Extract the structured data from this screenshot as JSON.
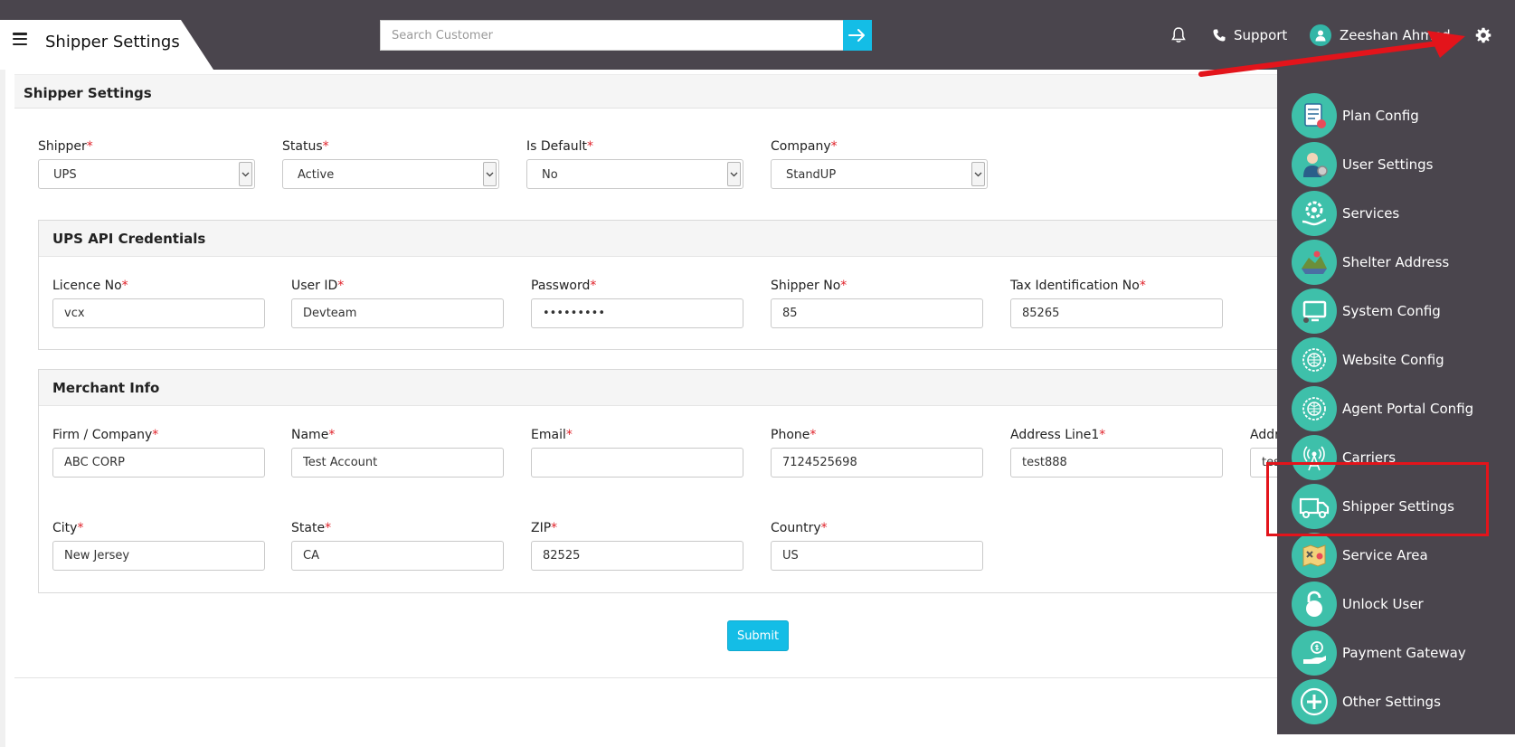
{
  "header": {
    "page_title": "Shipper Settings",
    "search_placeholder": "Search Customer",
    "support_label": "Support",
    "user_name": "Zeeshan Ahmed"
  },
  "panel": {
    "title": "Shipper Settings"
  },
  "filters": {
    "shipper": {
      "label": "Shipper",
      "value": "UPS"
    },
    "status": {
      "label": "Status",
      "value": "Active"
    },
    "is_default": {
      "label": "Is Default",
      "value": "No"
    },
    "company": {
      "label": "Company",
      "value": "StandUP"
    }
  },
  "api_credentials": {
    "title": "UPS API Credentials",
    "licence_no": {
      "label": "Licence No",
      "value": "vcx"
    },
    "user_id": {
      "label": "User ID",
      "value": "Devteam"
    },
    "password": {
      "label": "Password",
      "value": "•••••••••"
    },
    "shipper_no": {
      "label": "Shipper No",
      "value": "85"
    },
    "tax_id": {
      "label": "Tax Identification No",
      "value": "85265"
    }
  },
  "merchant": {
    "title": "Merchant Info",
    "firm": {
      "label": "Firm / Company",
      "value": "ABC CORP"
    },
    "name": {
      "label": "Name",
      "value": "Test Account"
    },
    "email": {
      "label": "Email",
      "value": ""
    },
    "phone": {
      "label": "Phone",
      "value": "7124525698"
    },
    "address1": {
      "label": "Address Line1",
      "value": "test888"
    },
    "address2": {
      "label": "Addr",
      "value": "tes"
    },
    "city": {
      "label": "City",
      "value": "New Jersey"
    },
    "state": {
      "label": "State",
      "value": "CA"
    },
    "zip": {
      "label": "ZIP",
      "value": "82525"
    },
    "country": {
      "label": "Country",
      "value": "US"
    }
  },
  "required_mark": "*",
  "submit_label": "Submit",
  "settings_menu": {
    "items": [
      {
        "label": "Plan Config",
        "icon": "plan-config-icon"
      },
      {
        "label": "User Settings",
        "icon": "user-settings-icon"
      },
      {
        "label": "Services",
        "icon": "services-icon"
      },
      {
        "label": "Shelter Address",
        "icon": "shelter-address-icon"
      },
      {
        "label": "System Config",
        "icon": "system-config-icon"
      },
      {
        "label": "Website Config",
        "icon": "website-config-icon"
      },
      {
        "label": "Agent Portal Config",
        "icon": "agent-portal-config-icon"
      },
      {
        "label": "Carriers",
        "icon": "carriers-icon"
      },
      {
        "label": "Shipper Settings",
        "icon": "shipper-settings-icon"
      },
      {
        "label": "Service Area",
        "icon": "service-area-icon"
      },
      {
        "label": "Unlock User",
        "icon": "unlock-user-icon"
      },
      {
        "label": "Payment Gateway",
        "icon": "payment-gateway-icon"
      },
      {
        "label": "Other Settings",
        "icon": "other-settings-icon"
      }
    ]
  },
  "colors": {
    "topbar": "#4a454d",
    "accent": "#14bde6",
    "menu_icon": "#3ec0aa",
    "required": "#e0222a",
    "highlight": "#e3141b"
  }
}
